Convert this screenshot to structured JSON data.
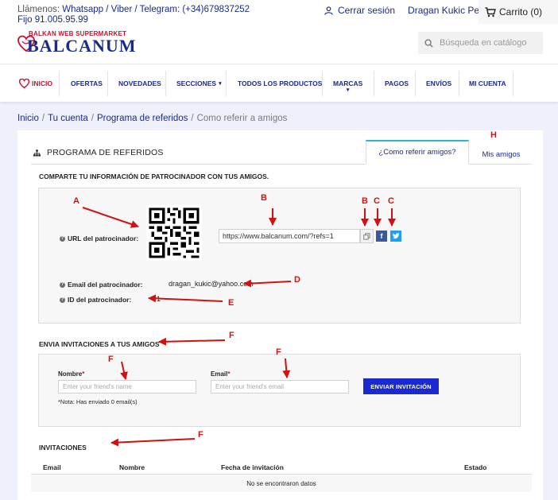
{
  "topbar": {
    "call_label": "Llámenos:",
    "whatsapp": "Whatsapp / Viber / Telegram: (+34)679837252",
    "fixed_phone": "Fijo 91.005.95.99",
    "logout": "Cerrar sesión",
    "user_name": "Dragan Kukic Petrovic",
    "cart": "Carrito (0)"
  },
  "header": {
    "logo_small": "BALKAN WEB SUPERMARKET",
    "logo_big": "BALCANUM",
    "search_placeholder": "Búsqueda en catálogo"
  },
  "nav": {
    "items": [
      "INICIO",
      "OFERTAS",
      "NOVEDADES",
      "SECCIONES",
      "TODOS LOS PRODUCTOS",
      "MARCAS",
      "PAGOS",
      "ENVÍOS",
      "MI CUENTA"
    ]
  },
  "breadcrumb": {
    "home": "Inicio",
    "account": "Tu cuenta",
    "program": "Programa de referidos",
    "current": "Como referir a amigos"
  },
  "referral": {
    "title": "PROGRAMA DE REFERIDOS",
    "tab_active": "¿Como referir amigos?",
    "tab_friends": "Mis amigos",
    "share_title": "COMPARTE TU INFORMACIÓN DE PATROCINADOR CON TUS AMIGOS.",
    "url_label": "URL del patrocinador:",
    "url_value": "https://www.balcanum.com/?refs=1",
    "email_label": "Email del patrocinador:",
    "email_value": "dragan_kukic@yahoo.com",
    "id_label": "ID del patrocinador:",
    "id_value": "1",
    "invite_title": "ENVIA INVITACIONES A TUS AMIGOS",
    "name_label": "Nombre",
    "name_placeholder": "Enter your friend's name",
    "email_field_label": "Email",
    "email_placeholder": "Enter your friend's email",
    "required_mark": "*",
    "send_button": "ENVIAR INVITACIÓN",
    "note": "*Nota: Has enviado 0 email(s)",
    "invitations_title": "INVITACIONES",
    "columns": [
      "Email",
      "Nombre",
      "Fecha de invitación",
      "Estado"
    ],
    "no_data": "No se encontraron datos"
  },
  "annotations": [
    "A",
    "B",
    "B",
    "C",
    "C",
    "D",
    "E",
    "F",
    "F",
    "F",
    "F",
    "H"
  ],
  "colors": {
    "brand_blue": "#1a2a8a",
    "brand_red": "#c8102e",
    "button_blue": "#1a2ad0",
    "tab_accent": "#2fb5d2",
    "annotation_red": "#d31010"
  }
}
